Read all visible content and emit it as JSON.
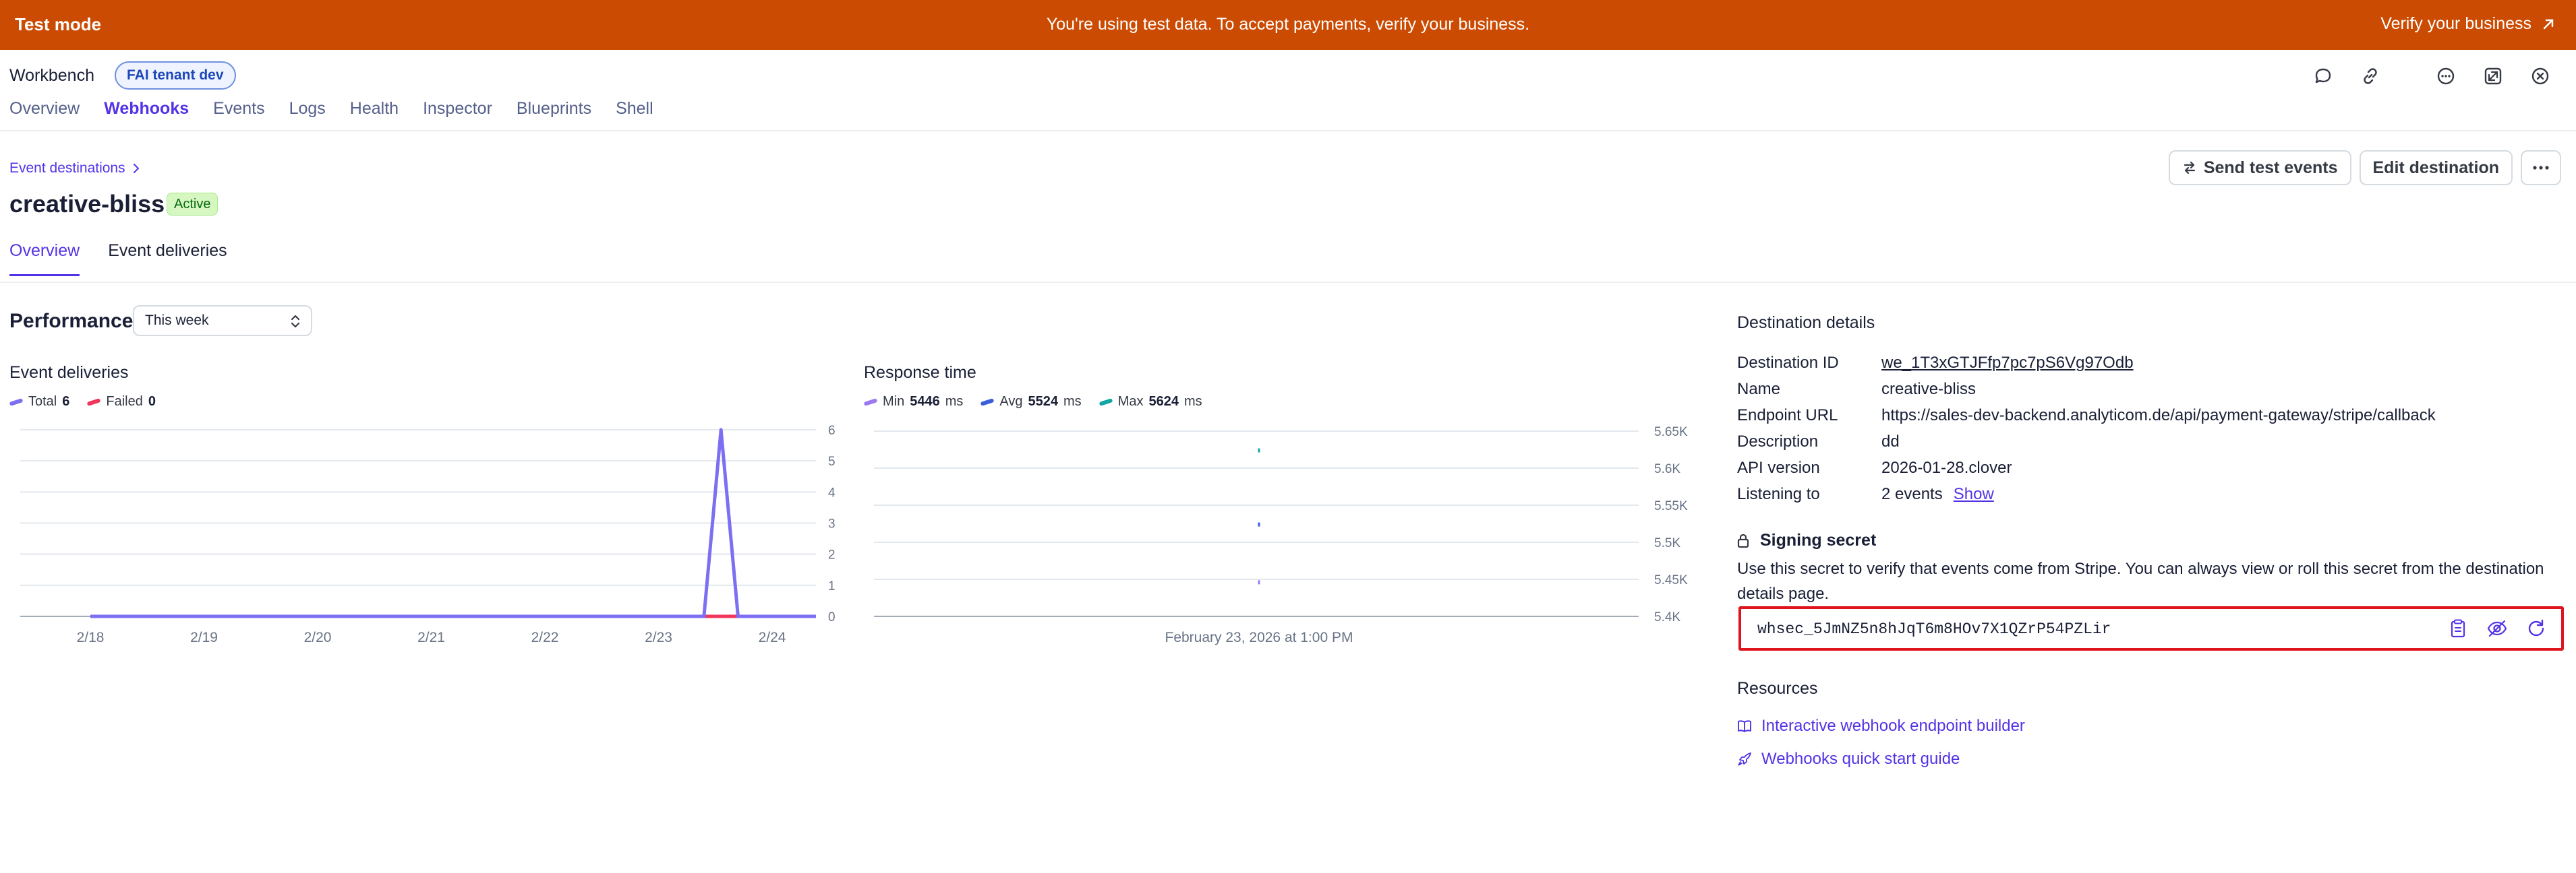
{
  "banner": {
    "mode_label": "Test mode",
    "message": "You're using test data. To accept payments, verify your business.",
    "action_label": "Verify your business",
    "bg_color": "#cb4b02"
  },
  "workbench": {
    "title": "Workbench",
    "env_badge": "FAI tenant dev",
    "tabs": [
      "Overview",
      "Webhooks",
      "Events",
      "Logs",
      "Health",
      "Inspector",
      "Blueprints",
      "Shell"
    ],
    "active_tab": "Webhooks",
    "header_icons": [
      "chat-bubble-icon",
      "link-icon",
      "more-horizontal-icon",
      "expand-icon",
      "close-icon"
    ]
  },
  "destination": {
    "breadcrumb": "Event destinations",
    "name": "creative-bliss",
    "status": "Active",
    "actions": {
      "send_test": "Send test events",
      "edit": "Edit destination"
    },
    "tabs": [
      "Overview",
      "Event deliveries"
    ],
    "active_tab": "Overview"
  },
  "performance": {
    "title": "Performance",
    "period": "This week"
  },
  "deliveries_chart": {
    "title": "Event deliveries",
    "legend": [
      {
        "name": "Total",
        "value": "6",
        "color": "#7c6ff2"
      },
      {
        "name": "Failed",
        "value": "0",
        "color": "#f0365c"
      }
    ]
  },
  "response_chart": {
    "title": "Response time",
    "legend": [
      {
        "name": "Min",
        "value": "5446",
        "unit": "ms",
        "color": "#9b7af0"
      },
      {
        "name": "Avg",
        "value": "5524",
        "unit": "ms",
        "color": "#3a5fd9"
      },
      {
        "name": "Max",
        "value": "5624",
        "unit": "ms",
        "color": "#13a5a5"
      }
    ],
    "x_label": "February 23, 2026 at 1:00 PM"
  },
  "chart_data": [
    {
      "type": "line",
      "title": "Event deliveries",
      "categories": [
        "2/18",
        "2/19",
        "2/20",
        "2/21",
        "2/22",
        "2/23",
        "2/24"
      ],
      "y_ticks": [
        "0",
        "1",
        "2",
        "3",
        "4",
        "5",
        "6"
      ],
      "ylim": [
        0,
        6
      ],
      "grid": true,
      "series": [
        {
          "name": "Total",
          "x": [
            0,
            5.4,
            5.55,
            5.7,
            6.4
          ],
          "y": [
            0,
            0,
            6,
            0,
            0
          ],
          "color": "#7c6ff2"
        },
        {
          "name": "Failed",
          "x": [
            0,
            6.4
          ],
          "y": [
            0,
            0
          ],
          "color": "#f0365c"
        }
      ]
    },
    {
      "type": "scatter",
      "title": "Response time",
      "x_label": "February 23, 2026 at 1:00 PM",
      "y_ticks": [
        "5.4K",
        "5.45K",
        "5.5K",
        "5.55K",
        "5.6K",
        "5.65K"
      ],
      "ylim": [
        5400,
        5650
      ],
      "grid": true,
      "series": [
        {
          "name": "Max",
          "y": [
            5624
          ],
          "color": "#13a5a5"
        },
        {
          "name": "Avg",
          "y": [
            5524
          ],
          "color": "#3a5fd9"
        },
        {
          "name": "Min",
          "y": [
            5446
          ],
          "color": "#9b7af0"
        }
      ]
    }
  ],
  "details": {
    "title": "Destination details",
    "rows": [
      {
        "key": "Destination ID",
        "value": "we_1T3xGTJFfp7pc7pS6Vg97Odb"
      },
      {
        "key": "Name",
        "value": "creative-bliss"
      },
      {
        "key": "Endpoint URL",
        "value": "https://sales-dev-backend.analyticom.de/api/payment-gateway/stripe/callback"
      },
      {
        "key": "Description",
        "value": "dd"
      },
      {
        "key": "API version",
        "value": "2026-01-28.clover"
      },
      {
        "key": "Listening to",
        "value": "2 events"
      }
    ],
    "show_label": "Show"
  },
  "signing_secret": {
    "title": "Signing secret",
    "description": "Use this secret to verify that events come from Stripe. You can always view or roll this secret from the destination details page.",
    "value": "whsec_5JmNZ5n8hJqT6m8HOv7X1QZrP54PZLir"
  },
  "resources": {
    "title": "Resources",
    "links": [
      "Interactive webhook endpoint builder",
      "Webhooks quick start guide"
    ]
  }
}
